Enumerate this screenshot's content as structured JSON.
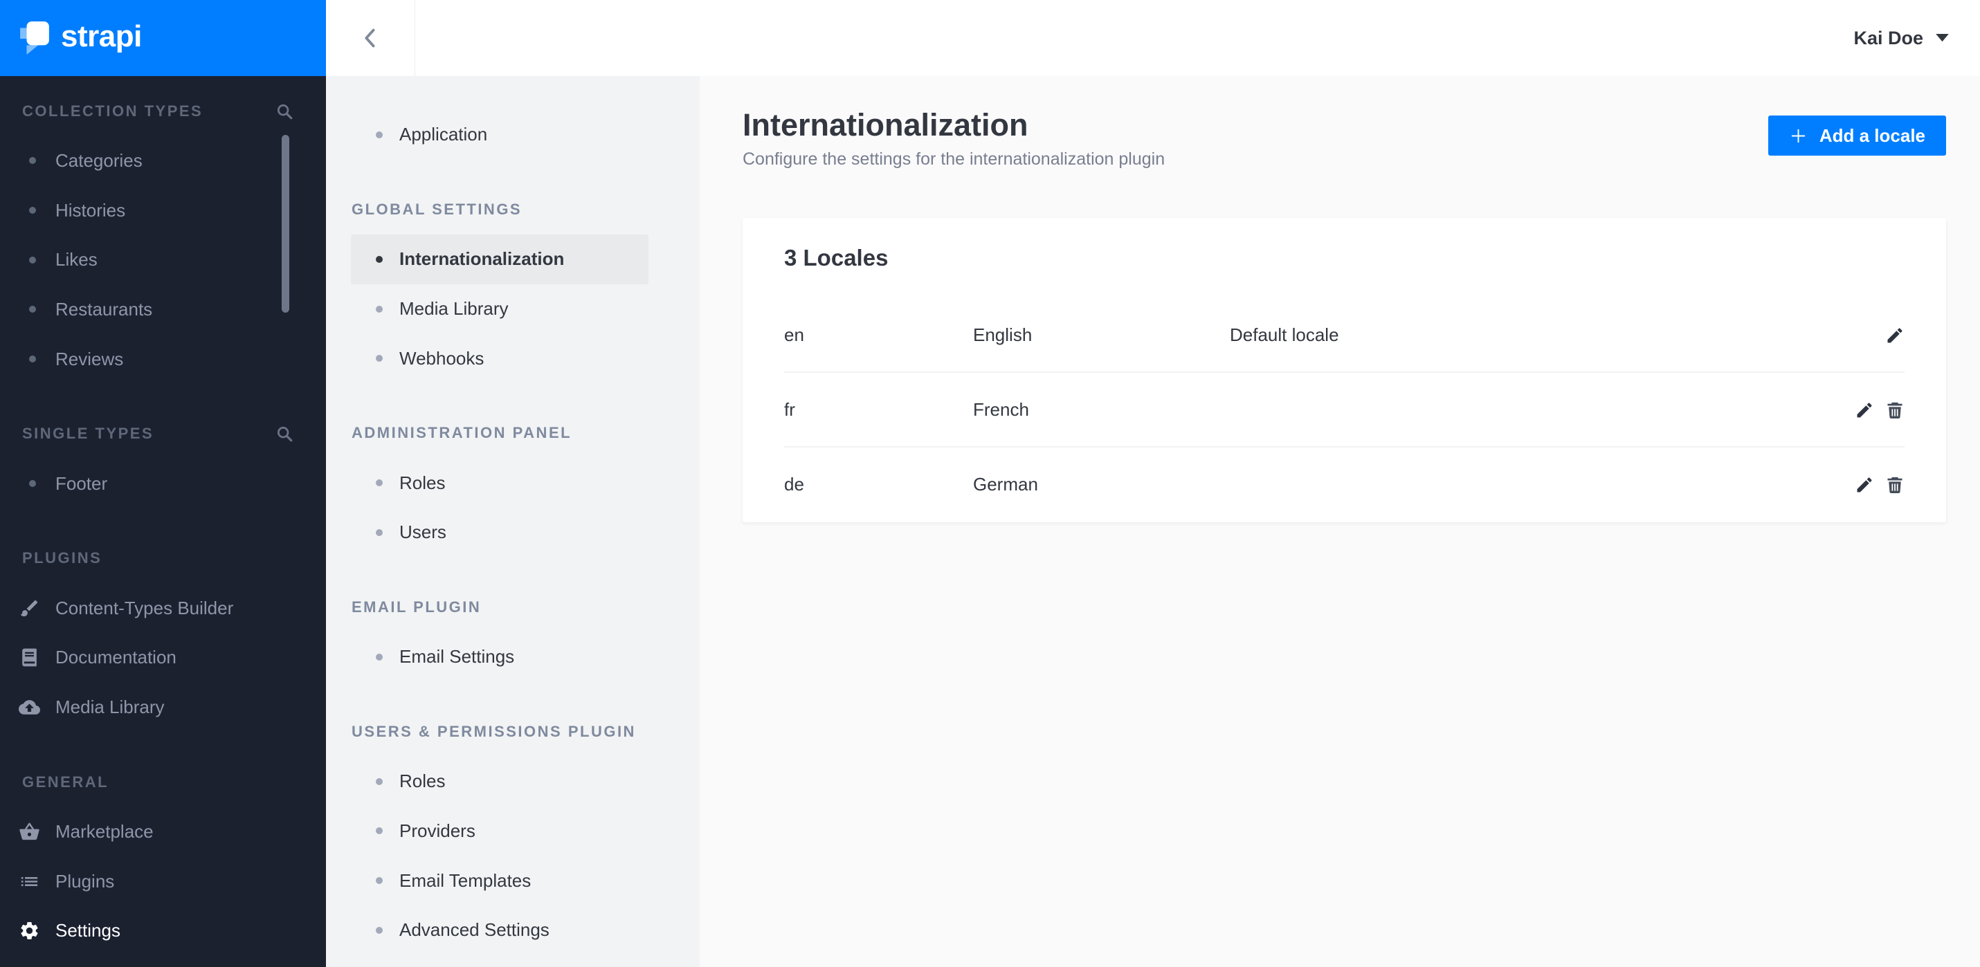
{
  "brand": {
    "name": "strapi",
    "logo_icon": "strapi-logo-icon"
  },
  "colors": {
    "brand_blue": "#007EFF",
    "sidebar_bg": "#1C2130",
    "sidebar_text": "#8E96A8",
    "subnav_bg": "#F2F3F4",
    "subnav_selected_bg": "#E9EAEB",
    "content_bg": "#FAFAFB",
    "text_dark": "#333740",
    "text_muted": "#787E8F",
    "divider": "#F3F3F5"
  },
  "left_sidebar": {
    "sections": [
      {
        "label": "COLLECTION TYPES",
        "search_icon": "search-icon",
        "items": [
          {
            "label": "Categories"
          },
          {
            "label": "Histories"
          },
          {
            "label": "Likes"
          },
          {
            "label": "Restaurants"
          },
          {
            "label": "Reviews"
          }
        ]
      },
      {
        "label": "SINGLE TYPES",
        "search_icon": "search-icon",
        "items": [
          {
            "label": "Footer"
          }
        ]
      },
      {
        "label": "PLUGINS",
        "items": [
          {
            "label": "Content-Types Builder",
            "icon": "brush-icon"
          },
          {
            "label": "Documentation",
            "icon": "book-icon"
          },
          {
            "label": "Media Library",
            "icon": "cloud-upload-icon"
          }
        ]
      },
      {
        "label": "GENERAL",
        "items": [
          {
            "label": "Marketplace",
            "icon": "basket-icon"
          },
          {
            "label": "Plugins",
            "icon": "list-icon"
          },
          {
            "label": "Settings",
            "icon": "gear-icon",
            "active": true
          }
        ]
      }
    ]
  },
  "topbar": {
    "back_icon": "chevron-left-icon",
    "user_name": "Kai Doe",
    "user_caret_icon": "caret-down-icon"
  },
  "settings_sidebar": {
    "groups": [
      {
        "label": "",
        "items": [
          {
            "label": "Application"
          }
        ]
      },
      {
        "label": "GLOBAL SETTINGS",
        "items": [
          {
            "label": "Internationalization",
            "active": true
          },
          {
            "label": "Media Library"
          },
          {
            "label": "Webhooks"
          }
        ]
      },
      {
        "label": "ADMINISTRATION PANEL",
        "items": [
          {
            "label": "Roles"
          },
          {
            "label": "Users"
          }
        ]
      },
      {
        "label": "EMAIL PLUGIN",
        "items": [
          {
            "label": "Email Settings"
          }
        ]
      },
      {
        "label": "USERS & PERMISSIONS PLUGIN",
        "items": [
          {
            "label": "Roles"
          },
          {
            "label": "Providers"
          },
          {
            "label": "Email Templates"
          },
          {
            "label": "Advanced Settings"
          }
        ]
      }
    ]
  },
  "page": {
    "title": "Internationalization",
    "subtitle": "Configure the settings for the internationalization plugin",
    "add_button_label": "Add a locale",
    "add_button_icon": "plus-icon"
  },
  "locales_table": {
    "title": "3 Locales",
    "edit_icon": "pencil-icon",
    "delete_icon": "trash-icon",
    "rows": [
      {
        "code": "en",
        "name": "English",
        "default_label": "Default locale",
        "can_delete": false
      },
      {
        "code": "fr",
        "name": "French",
        "default_label": "",
        "can_delete": true
      },
      {
        "code": "de",
        "name": "German",
        "default_label": "",
        "can_delete": true
      }
    ]
  }
}
